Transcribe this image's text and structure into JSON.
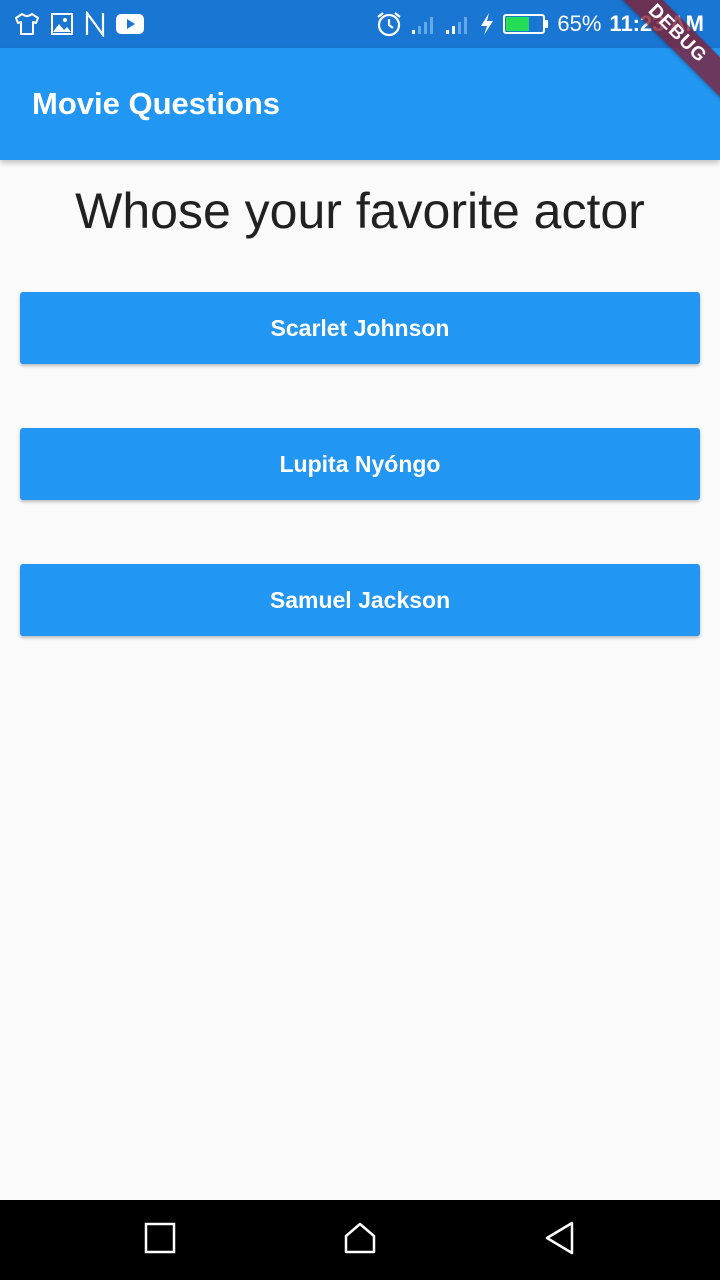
{
  "status_bar": {
    "icons_left": [
      "tshirt-icon",
      "image-icon",
      "n-icon",
      "youtube-icon"
    ],
    "icons_right": [
      "alarm-icon",
      "signal-icon",
      "signal-icon",
      "charging-icon",
      "battery-icon"
    ],
    "battery_percent": "65%",
    "battery_level": 0.65,
    "time": "11:23 AM"
  },
  "debug_banner": "DEBUG",
  "app_bar": {
    "title": "Movie Questions"
  },
  "question": {
    "text": "Whose your favorite actor"
  },
  "answers": [
    {
      "label": "Scarlet Johnson"
    },
    {
      "label": "Lupita Nyóngo"
    },
    {
      "label": "Samuel Jackson"
    }
  ],
  "nav_bar": {
    "buttons": [
      "recents-icon",
      "home-icon",
      "back-icon"
    ]
  },
  "colors": {
    "primary": "#2196f3",
    "status_bar": "#1976d2",
    "background": "#fafafa",
    "battery_fill": "#22dd55",
    "debug_banner": "#821e32"
  }
}
